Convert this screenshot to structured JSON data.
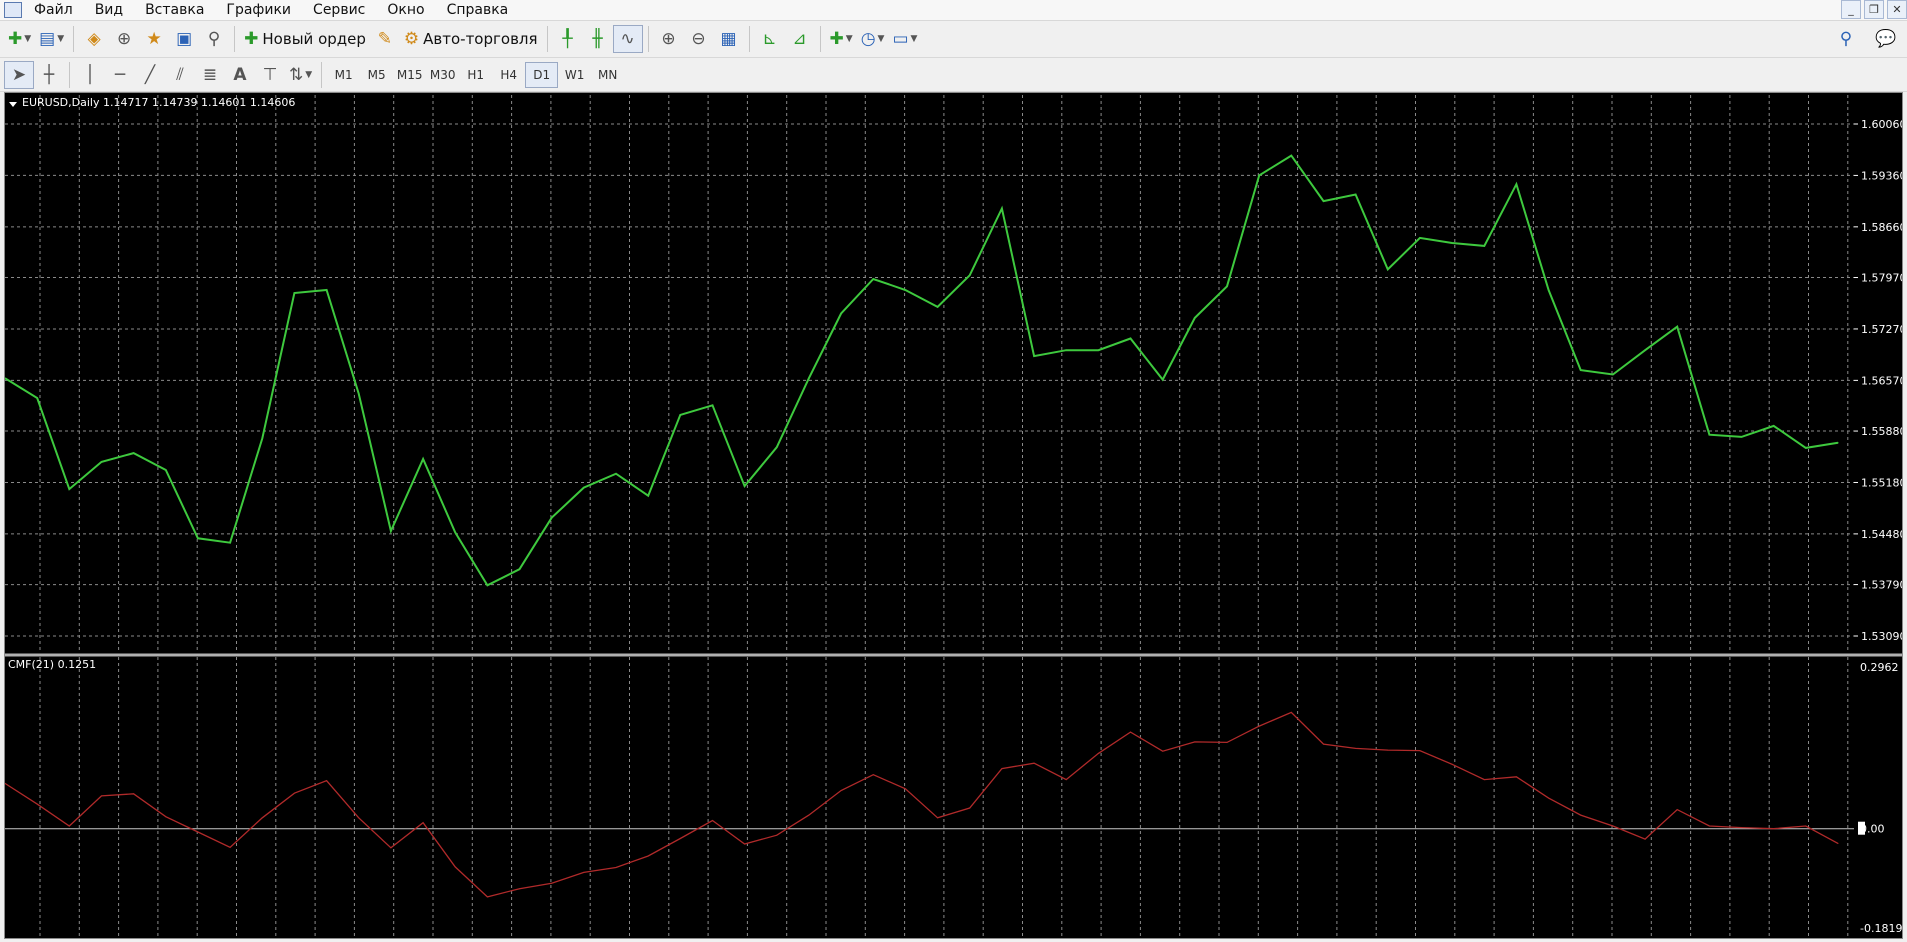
{
  "menu": {
    "items": [
      "Файл",
      "Вид",
      "Вставка",
      "Графики",
      "Сервис",
      "Окно",
      "Справка"
    ],
    "window_buttons": [
      "_",
      "❐",
      "✕"
    ]
  },
  "toolbar": {
    "new_order_label": "Новый ордер",
    "autotrading_label": "Авто-торговля"
  },
  "timeframes": {
    "items": [
      "M1",
      "M5",
      "M15",
      "M30",
      "H1",
      "H4",
      "D1",
      "W1",
      "MN"
    ],
    "active": "D1"
  },
  "main_chart": {
    "header": "EURUSD,Daily  1.14717 1.14739 1.14601 1.14606",
    "line_color": "#3ec93e"
  },
  "indicator": {
    "header": "CMF(21) 0.1251",
    "line_color": "#b02a2a",
    "zero_label": "0.00",
    "zero_line_color": "#c8c8c8"
  },
  "chart_data": [
    {
      "type": "line",
      "ylim": [
        1.5309,
        1.6006
      ],
      "y_ticks": [
        "1.60060",
        "1.59360",
        "1.58660",
        "1.57970",
        "1.57270",
        "1.56570",
        "1.55880",
        "1.55180",
        "1.54480",
        "1.53790",
        "1.53090"
      ],
      "grid": true,
      "series": [
        {
          "values": [
            1.566,
            1.5633,
            1.5509,
            1.5546,
            1.5558,
            1.5535,
            1.5442,
            1.5436,
            1.5578,
            1.5776,
            1.578,
            1.5639,
            1.5452,
            1.555,
            1.545,
            1.5378,
            1.54,
            1.547,
            1.5511,
            1.553,
            1.55,
            1.561,
            1.5623,
            1.5513,
            1.5566,
            1.566,
            1.5748,
            1.5795,
            1.578,
            1.5757,
            1.58,
            1.5891,
            1.569,
            1.5698,
            1.5698,
            1.5714,
            1.5658,
            1.5742,
            1.5785,
            1.5936,
            1.5963,
            1.5901,
            1.591,
            1.5808,
            1.5851,
            1.5844,
            1.584,
            1.5924,
            1.578,
            1.5671,
            1.5665,
            1.5698,
            1.573,
            1.5583,
            1.558,
            1.5595,
            1.5565,
            1.5572
          ]
        }
      ]
    },
    {
      "type": "line",
      "ylim": [
        -0.1819,
        0.2962
      ],
      "y_ticks": [
        "0.2962",
        "0.00",
        "-0.1819"
      ],
      "grid": true,
      "series": [
        {
          "values": [
            0.083,
            0.045,
            0.005,
            0.06,
            0.064,
            0.022,
            -0.006,
            -0.034,
            0.02,
            0.065,
            0.088,
            0.02,
            -0.035,
            0.011,
            -0.07,
            -0.125,
            -0.11,
            -0.1,
            -0.08,
            -0.071,
            -0.05,
            -0.018,
            0.015,
            -0.028,
            -0.012,
            0.025,
            0.07,
            0.099,
            0.073,
            0.02,
            0.038,
            0.11,
            0.12,
            0.09,
            0.138,
            0.177,
            0.142,
            0.159,
            0.158,
            0.188,
            0.213,
            0.155,
            0.147,
            0.144,
            0.143,
            0.118,
            0.09,
            0.095,
            0.056,
            0.025,
            0.005,
            -0.019,
            0.035,
            0.005,
            0.002,
            0.0,
            0.005,
            -0.027
          ]
        }
      ]
    }
  ]
}
